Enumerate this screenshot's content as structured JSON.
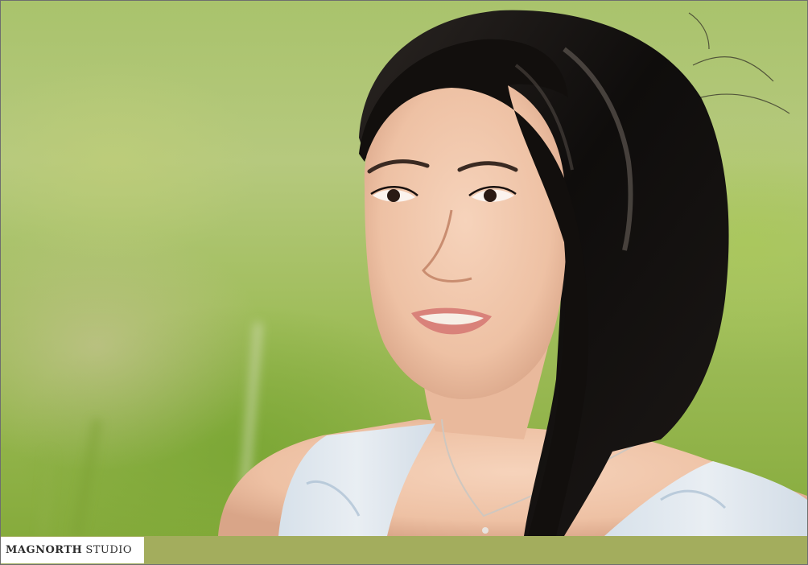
{
  "branding": {
    "name_bold": "MAGNORTH",
    "name_regular": "STUDIO"
  },
  "colors": {
    "footer_band": "#a3ad5d",
    "background_green": "#9fbd5a",
    "hair": "#141210",
    "skin": "#f0c7ad",
    "dress": "#dfe6ee"
  },
  "photo": {
    "subject": "portrait-woman"
  }
}
